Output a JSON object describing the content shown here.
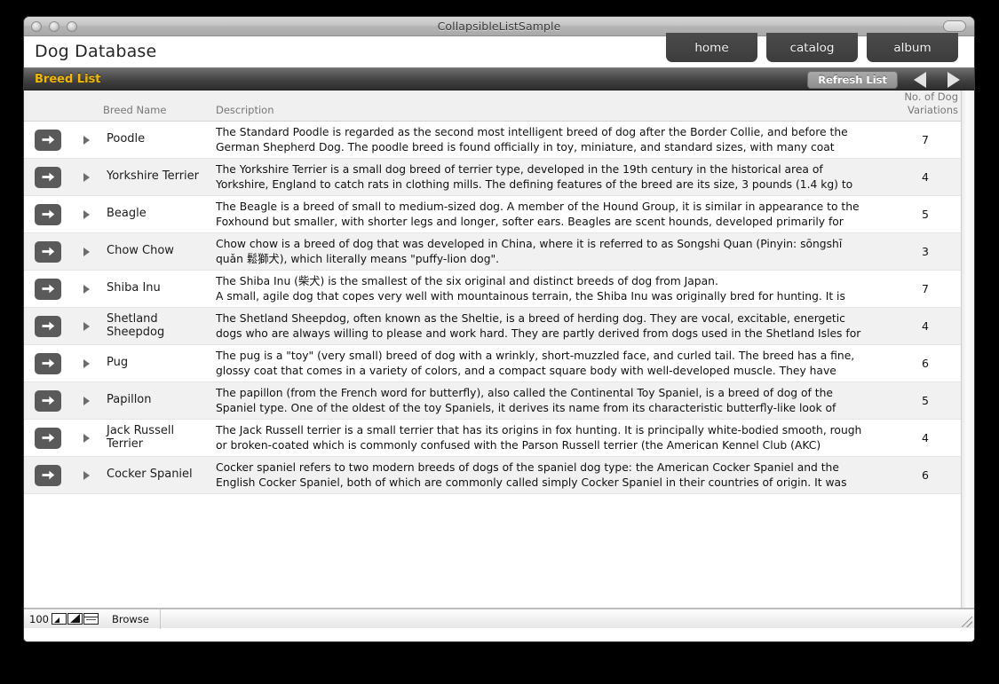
{
  "window": {
    "title": "CollapsibleListSample",
    "traffic_lights": [
      "close",
      "minimize",
      "zoom"
    ],
    "toolbar_toggle": "toolbar-toggle"
  },
  "header": {
    "app_title": "Dog Database",
    "tabs": [
      {
        "label": "home"
      },
      {
        "label": "catalog"
      },
      {
        "label": "album"
      }
    ]
  },
  "subbar": {
    "section_label": "Breed List",
    "refresh_label": "Refresh List",
    "prev_icon": "left-triangle-icon",
    "next_icon": "right-triangle-icon",
    "accent_color": "#f2b705"
  },
  "table": {
    "columns": {
      "go": "",
      "disclosure": "",
      "name": "Breed Name",
      "description": "Description",
      "count_line1": "No. of Dog",
      "count_line2": "Variations"
    },
    "rows": [
      {
        "name": "Poodle",
        "description": "The Standard Poodle is regarded as the second most intelligent breed of dog after the Border Collie, and before the German Shepherd Dog. The poodle breed is found officially in toy, miniature, and standard sizes, with many coat",
        "variations": "7"
      },
      {
        "name": "Yorkshire Terrier",
        "description": "The Yorkshire Terrier is a small dog breed of terrier type, developed in the 19th century in the historical area of Yorkshire, England to catch rats in clothing mills. The defining features of the breed are its size, 3 pounds (1.4 kg) to",
        "variations": "4"
      },
      {
        "name": "Beagle",
        "description": "The Beagle is a breed of small to medium-sized dog. A member of the Hound Group, it is similar in appearance to the Foxhound but smaller, with shorter legs and longer, softer ears. Beagles are scent hounds, developed primarily for",
        "variations": "5"
      },
      {
        "name": "Chow Chow",
        "description": "Chow chow is a breed of dog that was developed in China, where it is referred to as Songshi Quan (Pinyin: sōngshī quǎn 鬆獅犬), which literally means \"puffy-lion dog\".",
        "variations": "3"
      },
      {
        "name": "Shiba Inu",
        "description": "The Shiba Inu (柴犬) is the smallest of the six original and distinct breeds of dog from Japan.\nA small, agile dog that copes very well with mountainous terrain, the Shiba Inu was originally bred for hunting. It is",
        "variations": "7"
      },
      {
        "name": "Shetland Sheepdog",
        "description": "The Shetland Sheepdog, often known as the Sheltie, is a breed of herding dog. They are vocal, excitable, energetic dogs who are always willing to please and work hard. They are partly derived from dogs used in the Shetland Isles for",
        "variations": "4"
      },
      {
        "name": "Pug",
        "description": "The pug is a \"toy\" (very small) breed of dog with a wrinkly, short-muzzled face, and curled tail. The breed has a fine, glossy coat that comes in a variety of colors, and a compact square body with well-developed muscle. They have",
        "variations": "6"
      },
      {
        "name": "Papillon",
        "description": "The papillon (from the French word for butterfly), also called the Continental Toy Spaniel, is a breed of dog of the Spaniel type. One of the oldest of the toy Spaniels, it derives its name from its characteristic butterfly-like look of",
        "variations": "5"
      },
      {
        "name": "Jack Russell Terrier",
        "description": "The Jack Russell terrier is a small terrier that has its origins in fox hunting. It is principally white-bodied smooth, rough or broken-coated which is commonly confused with the Parson Russell terrier (the American Kennel Club (AKC)",
        "variations": "4"
      },
      {
        "name": "Cocker Spaniel",
        "description": "Cocker spaniel refers to two modern breeds of dogs of the spaniel dog type: the American Cocker Spaniel and the English Cocker Spaniel, both of which are commonly called simply Cocker Spaniel in their countries of origin. It was",
        "variations": "6"
      }
    ]
  },
  "statusbar": {
    "zoom_level": "100",
    "mode_label": "Browse",
    "icons": [
      "zoom-out-icon",
      "zoom-in-icon",
      "window-mode-icon"
    ]
  }
}
